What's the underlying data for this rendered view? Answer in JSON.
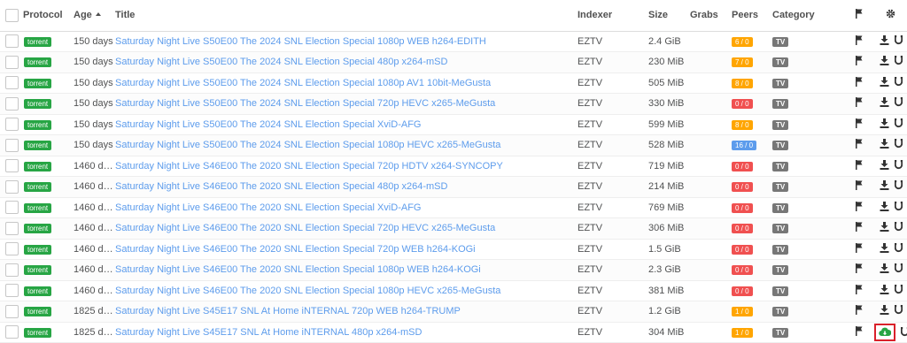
{
  "columns": {
    "protocol": "Protocol",
    "age": "Age",
    "title": "Title",
    "indexer": "Indexer",
    "size": "Size",
    "grabs": "Grabs",
    "peers": "Peers",
    "category": "Category"
  },
  "icons": {
    "header_flag": "flag-icon",
    "header_settings": "gear-icon",
    "row_flag": "flag-icon",
    "row_download": "download-icon",
    "row_magnet": "magnet-icon",
    "row_cloud": "cloud-download-icon"
  },
  "colors": {
    "protocol_badge": "#27a544",
    "title_link": "#5d9cec",
    "peers_warning": "#ffa500",
    "peers_danger": "#f05050",
    "peers_info": "#5d9cec",
    "category_badge": "#777777",
    "highlight_box": "#d9212a"
  },
  "rows": [
    {
      "protocol": "torrent",
      "age": "150 days",
      "title": "Saturday Night Live S50E00 The 2024 SNL Election Special 1080p WEB h264-EDITH",
      "indexer": "EZTV",
      "size": "2.4 GiB",
      "grabs": "",
      "peers": "6 / 0",
      "peers_status": "warning",
      "category": "TV"
    },
    {
      "protocol": "torrent",
      "age": "150 days",
      "title": "Saturday Night Live S50E00 The 2024 SNL Election Special 480p x264-mSD",
      "indexer": "EZTV",
      "size": "230 MiB",
      "grabs": "",
      "peers": "7 / 0",
      "peers_status": "warning",
      "category": "TV"
    },
    {
      "protocol": "torrent",
      "age": "150 days",
      "title": "Saturday Night Live S50E00 The 2024 SNL Election Special 1080p AV1 10bit-MeGusta",
      "indexer": "EZTV",
      "size": "505 MiB",
      "grabs": "",
      "peers": "8 / 0",
      "peers_status": "warning",
      "category": "TV"
    },
    {
      "protocol": "torrent",
      "age": "150 days",
      "title": "Saturday Night Live S50E00 The 2024 SNL Election Special 720p HEVC x265-MeGusta",
      "indexer": "EZTV",
      "size": "330 MiB",
      "grabs": "",
      "peers": "0 / 0",
      "peers_status": "danger",
      "category": "TV"
    },
    {
      "protocol": "torrent",
      "age": "150 days",
      "title": "Saturday Night Live S50E00 The 2024 SNL Election Special XviD-AFG",
      "indexer": "EZTV",
      "size": "599 MiB",
      "grabs": "",
      "peers": "8 / 0",
      "peers_status": "warning",
      "category": "TV"
    },
    {
      "protocol": "torrent",
      "age": "150 days",
      "title": "Saturday Night Live S50E00 The 2024 SNL Election Special 1080p HEVC x265-MeGusta",
      "indexer": "EZTV",
      "size": "528 MiB",
      "grabs": "",
      "peers": "16 / 0",
      "peers_status": "info",
      "category": "TV"
    },
    {
      "protocol": "torrent",
      "age": "1460 days",
      "title": "Saturday Night Live S46E00 The 2020 SNL Election Special 720p HDTV x264-SYNCOPY",
      "indexer": "EZTV",
      "size": "719 MiB",
      "grabs": "",
      "peers": "0 / 0",
      "peers_status": "danger",
      "category": "TV"
    },
    {
      "protocol": "torrent",
      "age": "1460 days",
      "title": "Saturday Night Live S46E00 The 2020 SNL Election Special 480p x264-mSD",
      "indexer": "EZTV",
      "size": "214 MiB",
      "grabs": "",
      "peers": "0 / 0",
      "peers_status": "danger",
      "category": "TV"
    },
    {
      "protocol": "torrent",
      "age": "1460 days",
      "title": "Saturday Night Live S46E00 The 2020 SNL Election Special XviD-AFG",
      "indexer": "EZTV",
      "size": "769 MiB",
      "grabs": "",
      "peers": "0 / 0",
      "peers_status": "danger",
      "category": "TV"
    },
    {
      "protocol": "torrent",
      "age": "1460 days",
      "title": "Saturday Night Live S46E00 The 2020 SNL Election Special 720p HEVC x265-MeGusta",
      "indexer": "EZTV",
      "size": "306 MiB",
      "grabs": "",
      "peers": "0 / 0",
      "peers_status": "danger",
      "category": "TV"
    },
    {
      "protocol": "torrent",
      "age": "1460 days",
      "title": "Saturday Night Live S46E00 The 2020 SNL Election Special 720p WEB h264-KOGi",
      "indexer": "EZTV",
      "size": "1.5 GiB",
      "grabs": "",
      "peers": "0 / 0",
      "peers_status": "danger",
      "category": "TV"
    },
    {
      "protocol": "torrent",
      "age": "1460 days",
      "title": "Saturday Night Live S46E00 The 2020 SNL Election Special 1080p WEB h264-KOGi",
      "indexer": "EZTV",
      "size": "2.3 GiB",
      "grabs": "",
      "peers": "0 / 0",
      "peers_status": "danger",
      "category": "TV"
    },
    {
      "protocol": "torrent",
      "age": "1460 days",
      "title": "Saturday Night Live S46E00 The 2020 SNL Election Special 1080p HEVC x265-MeGusta",
      "indexer": "EZTV",
      "size": "381 MiB",
      "grabs": "",
      "peers": "0 / 0",
      "peers_status": "danger",
      "category": "TV"
    },
    {
      "protocol": "torrent",
      "age": "1825 days",
      "title": "Saturday Night Live S45E17 SNL At Home iNTERNAL 720p WEB h264-TRUMP",
      "indexer": "EZTV",
      "size": "1.2 GiB",
      "grabs": "",
      "peers": "1 / 0",
      "peers_status": "warning",
      "category": "TV"
    },
    {
      "protocol": "torrent",
      "age": "1825 days",
      "title": "Saturday Night Live S45E17 SNL At Home iNTERNAL 480p x264-mSD",
      "indexer": "EZTV",
      "size": "304 MiB",
      "grabs": "",
      "peers": "1 / 0",
      "peers_status": "warning",
      "category": "TV",
      "download_state": "cloud",
      "highlighted": true
    }
  ]
}
